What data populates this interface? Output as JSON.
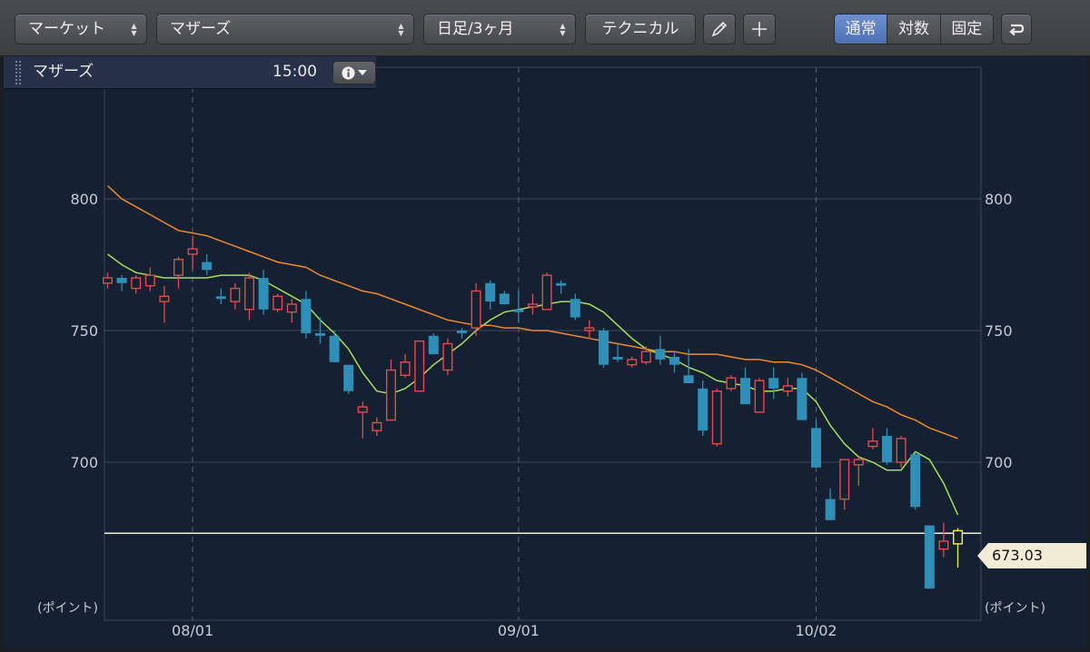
{
  "toolbar": {
    "market_select": "マーケット",
    "index_select": "マザーズ",
    "period_select": "日足/3ヶ月",
    "technical_button": "テクニカル",
    "scale_modes": [
      "通常",
      "対数",
      "固定"
    ],
    "active_scale": "通常",
    "updown_glyph": "▲▼"
  },
  "info": {
    "title": "マザーズ",
    "time": "15:00"
  },
  "colors": {
    "up": "#e24b4b",
    "down": "#2f8fb6",
    "last": "#f3ef55",
    "ma_short": "#a6e05a",
    "ma_long": "#f08a2a",
    "price_line": "#f4efd8",
    "grid": "#3a4659",
    "background": "#162033"
  },
  "chart_data": {
    "type": "candlestick",
    "y_unit_label": "(ポイント)",
    "ylim": [
      640,
      850
    ],
    "yticks": [
      700,
      750,
      800
    ],
    "xticks": [
      {
        "label": "08/01",
        "index": 6
      },
      {
        "label": "09/01",
        "index": 29
      },
      {
        "label": "10/02",
        "index": 50
      }
    ],
    "current_price": "673.03",
    "current_price_value": 673.03,
    "grid": true,
    "series": [
      {
        "kind": "candle",
        "ohlc": [
          [
            768,
            772,
            766,
            770
          ],
          [
            770,
            771,
            765,
            768
          ],
          [
            766,
            771,
            764,
            770
          ],
          [
            767,
            774,
            765,
            771
          ],
          [
            761,
            767,
            753,
            763
          ],
          [
            771,
            778,
            766,
            777
          ],
          [
            779,
            786,
            773,
            781
          ],
          [
            776,
            779,
            771,
            773
          ],
          [
            763,
            766,
            760,
            762
          ],
          [
            761,
            768,
            758,
            766
          ],
          [
            758,
            772,
            754,
            770
          ],
          [
            770,
            773,
            756,
            758
          ],
          [
            758,
            764,
            757,
            763
          ],
          [
            757,
            762,
            753,
            760
          ],
          [
            762,
            765,
            747,
            749
          ],
          [
            749,
            755,
            745,
            748
          ],
          [
            748,
            750,
            738,
            738
          ],
          [
            737,
            737,
            726,
            727
          ],
          [
            719,
            723,
            709,
            721
          ],
          [
            712,
            717,
            710,
            715
          ],
          [
            716,
            739,
            716,
            735
          ],
          [
            733,
            741,
            732,
            738
          ],
          [
            727,
            746,
            727,
            746
          ],
          [
            748,
            749,
            741,
            741
          ],
          [
            735,
            747,
            733,
            745
          ],
          [
            750,
            751,
            747,
            749
          ],
          [
            751,
            768,
            748,
            765
          ],
          [
            768,
            769,
            758,
            761
          ],
          [
            764,
            765,
            761,
            760
          ],
          [
            758,
            765,
            753,
            757
          ],
          [
            759,
            764,
            756,
            760
          ],
          [
            758,
            772,
            758,
            771
          ],
          [
            768,
            769,
            764,
            767
          ],
          [
            762,
            764,
            754,
            755
          ],
          [
            750,
            754,
            747,
            751
          ],
          [
            750,
            751,
            736,
            737
          ],
          [
            740,
            745,
            738,
            739
          ],
          [
            737,
            740,
            736,
            739
          ],
          [
            738,
            744,
            737,
            742
          ],
          [
            743,
            748,
            737,
            739
          ],
          [
            740,
            742,
            734,
            737
          ],
          [
            733,
            743,
            731,
            730
          ],
          [
            728,
            731,
            710,
            712
          ],
          [
            707,
            728,
            706,
            727
          ],
          [
            728,
            733,
            727,
            732
          ],
          [
            732,
            736,
            722,
            722
          ],
          [
            719,
            732,
            719,
            731
          ],
          [
            732,
            736,
            724,
            728
          ],
          [
            727,
            732,
            725,
            729
          ],
          [
            732,
            734,
            716,
            716
          ],
          [
            713,
            716,
            700,
            698
          ],
          [
            686,
            690,
            678,
            678
          ],
          [
            686,
            701,
            682,
            701
          ],
          [
            699,
            702,
            691,
            701
          ],
          [
            706,
            713,
            705,
            708
          ],
          [
            710,
            713,
            699,
            700
          ],
          [
            700,
            710,
            698,
            709
          ],
          [
            703,
            704,
            682,
            683
          ],
          [
            676,
            676,
            652,
            652
          ],
          [
            667,
            677,
            664,
            670
          ],
          [
            669,
            675,
            660,
            674
          ]
        ]
      },
      {
        "kind": "line",
        "name": "",
        "values": [
          779,
          775,
          772,
          771,
          770,
          770,
          770,
          770,
          771,
          771,
          771,
          769,
          766,
          763,
          760,
          754,
          749,
          743,
          734,
          727,
          726,
          728,
          732,
          737,
          741,
          745,
          750,
          754,
          757,
          758,
          759,
          760,
          761,
          761,
          760,
          757,
          752,
          747,
          743,
          741,
          739,
          736,
          734,
          731,
          730,
          729,
          727,
          727,
          728,
          728,
          723,
          714,
          707,
          702,
          700,
          697,
          697,
          704,
          701,
          692,
          680
        ]
      },
      {
        "kind": "line",
        "name": "",
        "values": [
          805,
          800,
          797,
          794,
          791,
          788,
          787,
          786,
          784,
          782,
          780,
          778,
          776,
          775,
          774,
          771,
          769,
          767,
          765,
          764,
          762,
          760,
          758,
          756,
          754,
          753,
          752,
          752,
          751,
          751,
          750,
          750,
          749,
          748,
          747,
          746,
          745,
          744,
          743,
          742,
          742,
          741,
          741,
          741,
          740,
          739,
          739,
          738,
          738,
          737,
          735,
          732,
          729,
          726,
          723,
          721,
          718,
          716,
          713,
          711,
          709
        ]
      }
    ]
  }
}
